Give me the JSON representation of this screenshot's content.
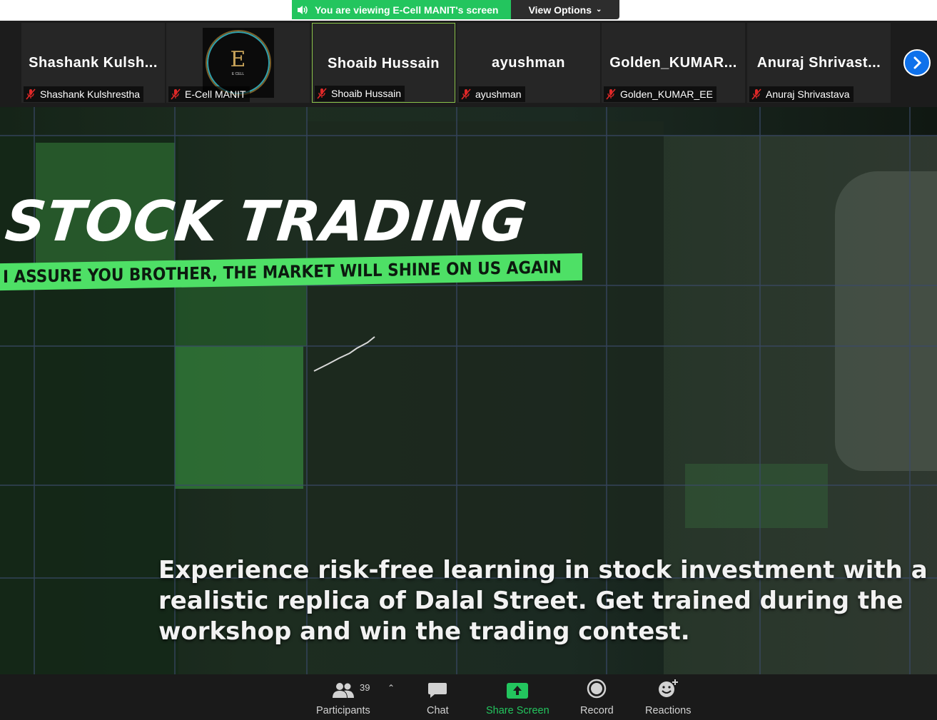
{
  "banner": {
    "viewing_text": "You are viewing E-Cell MANIT's screen",
    "view_options_label": "View Options",
    "banner_color": "#23c55e"
  },
  "participants": [
    {
      "big_name": "Shashank  Kulsh...",
      "label": "Shashank Kulshrestha",
      "muted": true
    },
    {
      "big_name": "",
      "label": "E-Cell MANIT",
      "muted": true,
      "logo_icon": "ecell-logo",
      "logo_letter": "E",
      "logo_text": "E CELL"
    },
    {
      "big_name": "Shoaib Hussain",
      "label": "Shoaib Hussain",
      "muted": true,
      "active": true
    },
    {
      "big_name": "ayushman",
      "label": "ayushman",
      "muted": true
    },
    {
      "big_name": "Golden_KUMAR...",
      "label": "Golden_KUMAR_EE",
      "muted": true
    },
    {
      "big_name": "Anuraj  Shrivast...",
      "label": "Anuraj Shrivastava",
      "muted": true
    }
  ],
  "shared_content": {
    "title": "STOCK TRADING",
    "tagline": "I ASSURE YOU BROTHER, THE MARKET WILL SHINE ON US AGAIN",
    "description_lines": [
      "Experience risk-free learning in stock investment with a",
      "realistic replica of Dalal Street. Get trained during the",
      "workshop and win the trading contest."
    ],
    "accent_color": "#4ee066"
  },
  "toolbar": {
    "participants_label": "Participants",
    "participants_count": "39",
    "chat_label": "Chat",
    "share_label": "Share Screen",
    "record_label": "Record",
    "reactions_label": "Reactions",
    "share_color": "#23c55e"
  }
}
